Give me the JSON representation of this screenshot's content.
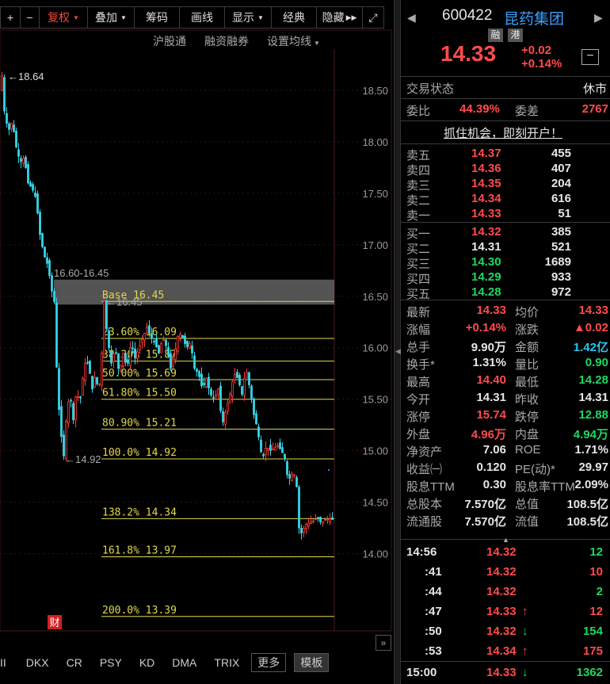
{
  "toolbar": {
    "items": [
      "复权",
      "叠加",
      "筹码",
      "画线",
      "显示",
      "经典",
      "隐藏"
    ],
    "plus": "+",
    "minus": "−",
    "hide_arrows": "▶▶",
    "fullscreen": "⤢"
  },
  "subbar": {
    "items": [
      "沪股通",
      "融资融券",
      "设置均线"
    ]
  },
  "bottom_tabs": [
    "II",
    "DKX",
    "CR",
    "PSY",
    "KD",
    "DMA",
    "TRIX",
    "更多",
    "模板"
  ],
  "chart_data": {
    "type": "candlestick",
    "y_ticks": [
      18.5,
      18.0,
      17.5,
      17.0,
      16.5,
      16.0,
      15.5,
      15.0,
      14.5,
      14.0
    ],
    "ylim": [
      13.25,
      18.9
    ],
    "path": [
      [
        0,
        18.5
      ],
      [
        2,
        18.64
      ],
      [
        5,
        18.3
      ],
      [
        10,
        18.1
      ],
      [
        15,
        18.2
      ],
      [
        20,
        17.95
      ],
      [
        25,
        17.8
      ],
      [
        30,
        17.85
      ],
      [
        35,
        17.6
      ],
      [
        40,
        17.55
      ],
      [
        45,
        17.45
      ],
      [
        50,
        17.1
      ],
      [
        55,
        16.9
      ],
      [
        60,
        16.8
      ],
      [
        65,
        16.55
      ],
      [
        68,
        16.45
      ],
      [
        72,
        15.6
      ],
      [
        76,
        15.2
      ],
      [
        80,
        14.95
      ],
      [
        84,
        15.4
      ],
      [
        88,
        15.55
      ],
      [
        92,
        15.3
      ],
      [
        96,
        15.6
      ],
      [
        100,
        15.45
      ],
      [
        104,
        15.7
      ],
      [
        108,
        15.9
      ],
      [
        112,
        15.8
      ],
      [
        116,
        15.6
      ],
      [
        120,
        15.75
      ],
      [
        124,
        15.55
      ],
      [
        128,
        15.95
      ],
      [
        131,
        16.45
      ],
      [
        135,
        16.1
      ],
      [
        140,
        15.85
      ],
      [
        145,
        16.0
      ],
      [
        150,
        15.75
      ],
      [
        155,
        15.95
      ],
      [
        160,
        15.8
      ],
      [
        165,
        16.05
      ],
      [
        170,
        15.9
      ],
      [
        175,
        16.0
      ],
      [
        180,
        16.1
      ],
      [
        185,
        16.2
      ],
      [
        190,
        16.1
      ],
      [
        195,
        16.05
      ],
      [
        200,
        15.95
      ],
      [
        205,
        16.1
      ],
      [
        210,
        16.0
      ],
      [
        215,
        15.8
      ],
      [
        220,
        15.95
      ],
      [
        225,
        16.15
      ],
      [
        230,
        16.1
      ],
      [
        235,
        16.0
      ],
      [
        240,
        16.05
      ],
      [
        245,
        15.8
      ],
      [
        250,
        15.75
      ],
      [
        255,
        15.6
      ],
      [
        260,
        15.7
      ],
      [
        265,
        15.55
      ],
      [
        270,
        15.5
      ],
      [
        275,
        15.6
      ],
      [
        280,
        15.25
      ],
      [
        285,
        15.4
      ],
      [
        290,
        15.55
      ],
      [
        295,
        15.75
      ],
      [
        300,
        15.7
      ],
      [
        305,
        15.55
      ],
      [
        310,
        15.8
      ],
      [
        315,
        15.6
      ],
      [
        320,
        15.35
      ],
      [
        325,
        15.2
      ],
      [
        328,
        15.0
      ],
      [
        332,
        14.95
      ],
      [
        336,
        15.05
      ],
      [
        340,
        15.0
      ],
      [
        345,
        15.02
      ],
      [
        350,
        15.05
      ],
      [
        355,
        15.0
      ],
      [
        360,
        14.9
      ],
      [
        363,
        14.7
      ],
      [
        366,
        14.75
      ],
      [
        370,
        14.8
      ],
      [
        374,
        14.65
      ],
      [
        377,
        14.25
      ],
      [
        380,
        14.2
      ],
      [
        385,
        14.28
      ],
      [
        390,
        14.3
      ],
      [
        395,
        14.32
      ],
      [
        400,
        14.35
      ],
      [
        405,
        14.3
      ],
      [
        410,
        14.33
      ],
      [
        415,
        14.34
      ],
      [
        420,
        14.33
      ]
    ],
    "annotations": {
      "high": {
        "label": "18.64",
        "value": 18.64
      },
      "low": {
        "label": "14.92",
        "value": 14.92
      },
      "last": {
        "label": "16.45",
        "value": 16.45
      },
      "range": {
        "label": "16.60-16.45",
        "top": 16.6,
        "bottom": 16.45
      }
    },
    "fib_levels": [
      {
        "label": "Base",
        "pct": "",
        "price": "16.45",
        "value": 16.45
      },
      {
        "label": "23.60%",
        "pct": "23.60%",
        "price": "16.09",
        "value": 16.09
      },
      {
        "label": "38.20%",
        "pct": "38.20%",
        "price": "15.87",
        "value": 15.87
      },
      {
        "label": "50.00%",
        "pct": "50.00%",
        "price": "15.69",
        "value": 15.69
      },
      {
        "label": "61.80%",
        "pct": "61.80%",
        "price": "15.50",
        "value": 15.5
      },
      {
        "label": "80.90%",
        "pct": "80.90%",
        "price": "15.21",
        "value": 15.21
      },
      {
        "label": "100.0%",
        "pct": "100.0%",
        "price": "14.92",
        "value": 14.92
      },
      {
        "label": "138.2%",
        "pct": "138.2%",
        "price": "14.34",
        "value": 14.34
      },
      {
        "label": "161.8%",
        "pct": "161.8%",
        "price": "13.97",
        "value": 13.97
      },
      {
        "label": "200.0%",
        "pct": "200.0%",
        "price": "13.39",
        "value": 13.39
      }
    ],
    "colors": {
      "up": "#ff3b3b",
      "down": "#35d6e6",
      "fib": "#e0d84a",
      "grid": "#3a1010",
      "axis": "#9a9a9a"
    },
    "finance_badge": "财"
  },
  "quote": {
    "code": "600422",
    "name": "昆药集团",
    "tags": [
      "融",
      "港"
    ],
    "price": "14.33",
    "change": "+0.02",
    "change_pct": "+0.14%",
    "trade_status_label": "交易状态",
    "trade_status": "休市",
    "weibi_label": "委比",
    "weibi": "44.39%",
    "weicha_label": "委差",
    "weicha": "2767",
    "promo": "抓住机会，即刻开户！"
  },
  "sell": [
    {
      "label": "卖五",
      "price": "14.37",
      "vol": "455"
    },
    {
      "label": "卖四",
      "price": "14.36",
      "vol": "407"
    },
    {
      "label": "卖三",
      "price": "14.35",
      "vol": "204"
    },
    {
      "label": "卖二",
      "price": "14.34",
      "vol": "616"
    },
    {
      "label": "卖一",
      "price": "14.33",
      "vol": "51"
    }
  ],
  "buy": [
    {
      "label": "买一",
      "price": "14.32",
      "vol": "385",
      "color": "red"
    },
    {
      "label": "买二",
      "price": "14.31",
      "vol": "521",
      "color": "white"
    },
    {
      "label": "买三",
      "price": "14.30",
      "vol": "1689",
      "color": "green"
    },
    {
      "label": "买四",
      "price": "14.29",
      "vol": "933",
      "color": "green"
    },
    {
      "label": "买五",
      "price": "14.28",
      "vol": "972",
      "color": "green"
    }
  ],
  "stats": [
    [
      {
        "k": "最新",
        "v": "14.33",
        "c": "red"
      },
      {
        "k": "均价",
        "v": "14.33",
        "c": "red"
      }
    ],
    [
      {
        "k": "涨幅",
        "v": "+0.14%",
        "c": "red"
      },
      {
        "k": "涨跌",
        "v": "▲0.02",
        "c": "red"
      }
    ],
    [
      {
        "k": "总手",
        "v": "9.90万",
        "c": "white"
      },
      {
        "k": "金额",
        "v": "1.42亿",
        "c": "cyan"
      }
    ],
    [
      {
        "k": "换手*",
        "v": "1.31%",
        "c": "white"
      },
      {
        "k": "量比",
        "v": "0.90",
        "c": "green"
      }
    ],
    [
      {
        "k": "最高",
        "v": "14.40",
        "c": "red"
      },
      {
        "k": "最低",
        "v": "14.28",
        "c": "green"
      }
    ],
    [
      {
        "k": "今开",
        "v": "14.31",
        "c": "white"
      },
      {
        "k": "昨收",
        "v": "14.31",
        "c": "white"
      }
    ],
    [
      {
        "k": "涨停",
        "v": "15.74",
        "c": "red"
      },
      {
        "k": "跌停",
        "v": "12.88",
        "c": "green"
      }
    ],
    [
      {
        "k": "外盘",
        "v": "4.96万",
        "c": "red"
      },
      {
        "k": "内盘",
        "v": "4.94万",
        "c": "green"
      }
    ],
    [
      {
        "k": "净资产",
        "v": "7.06",
        "c": "white"
      },
      {
        "k": "ROE",
        "v": "1.71%",
        "c": "white"
      }
    ],
    [
      {
        "k": "收益㈠",
        "v": "0.120",
        "c": "white"
      },
      {
        "k": "PE(动)*",
        "v": "29.97",
        "c": "white"
      }
    ],
    [
      {
        "k": "股息TTM",
        "v": "0.30",
        "c": "white"
      },
      {
        "k": "股息率TTM",
        "v": "2.09%",
        "c": "white"
      }
    ],
    [
      {
        "k": "总股本",
        "v": "7.570亿",
        "c": "white"
      },
      {
        "k": "总值",
        "v": "108.5亿",
        "c": "white"
      }
    ],
    [
      {
        "k": "流通股",
        "v": "7.570亿",
        "c": "white"
      },
      {
        "k": "流值",
        "v": "108.5亿",
        "c": "white"
      }
    ]
  ],
  "ticks": [
    {
      "time": "14:56",
      "price": "14.32",
      "pc": "red",
      "arrow": "",
      "ac": "",
      "vol": "12",
      "vc": "green"
    },
    {
      "time": ":41",
      "price": "14.32",
      "pc": "red",
      "arrow": "",
      "ac": "",
      "vol": "10",
      "vc": "red"
    },
    {
      "time": ":44",
      "price": "14.32",
      "pc": "red",
      "arrow": "",
      "ac": "",
      "vol": "2",
      "vc": "green"
    },
    {
      "time": ":47",
      "price": "14.33",
      "pc": "red",
      "arrow": "↑",
      "ac": "red",
      "vol": "12",
      "vc": "red"
    },
    {
      "time": ":50",
      "price": "14.32",
      "pc": "red",
      "arrow": "↓",
      "ac": "green",
      "vol": "154",
      "vc": "green"
    },
    {
      "time": ":53",
      "price": "14.34",
      "pc": "red",
      "arrow": "↑",
      "ac": "red",
      "vol": "175",
      "vc": "red"
    },
    {
      "time": "15:00",
      "price": "14.33",
      "pc": "red",
      "arrow": "↓",
      "ac": "green",
      "vol": "1362",
      "vc": "green"
    }
  ]
}
